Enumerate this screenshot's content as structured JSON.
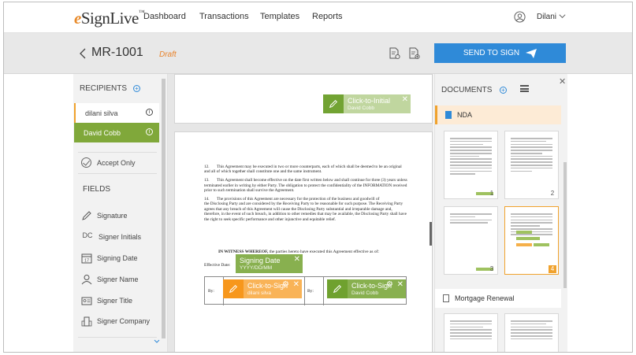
{
  "nav": {
    "logo_e": "e",
    "logo_rest": "SignLive",
    "logo_tm": "™",
    "items": [
      "Dashboard",
      "Transactions",
      "Templates",
      "Reports"
    ],
    "user": "Dilani"
  },
  "header": {
    "title": "MR-1001",
    "status": "Draft",
    "send_label": "SEND TO SIGN"
  },
  "left": {
    "recipients_label": "RECIPIENTS",
    "recipients": [
      "dilani silva",
      "David Cobb"
    ],
    "accept_only_label": "Accept Only",
    "fields_label": "FIELDS",
    "fields": [
      {
        "icon": "pen-icon",
        "label": "Signature"
      },
      {
        "icon": "dc-icon",
        "icon_text": "DC",
        "label": "Signer Initials"
      },
      {
        "icon": "calendar-icon",
        "icon_text": "17",
        "label": "Signing Date"
      },
      {
        "icon": "person-icon",
        "label": "Signer Name"
      },
      {
        "icon": "id-card-icon",
        "label": "Signer Title"
      },
      {
        "icon": "building-icon",
        "label": "Signer Company"
      }
    ]
  },
  "doc": {
    "initial_field": {
      "label": "Click-to-Initial",
      "name": "David Cobb"
    },
    "para12": "This Agreement may be executed in two or more counterparts, each of which shall be deemed to be an original and all of which together shall constitute one and the same instrument.",
    "para13": "This Agreement shall become effective on the date first written below and shall continue for three (3) years unless terminated earlier in writing by either Party. The obligation to protect the confidentiality of the INFORMATION received prior to such termination shall survive the Agreement.",
    "para14a": "The provisions of this Agreement are necessary for the protection of the business and goodwill of",
    "para14b": "the Disclosing Party and are considered by the Receiving Party to be reasonable for such purpose. The Receiving Party agrees that any breach of this Agreement will cause the Disclosing Party substantial and irreparable damage and, therefore, in the event of such breach, in addition to other remedies that may be available, the Disclosing Party shall have the right to seek specific performance and other injunctive and equitable relief.",
    "num12": "12.",
    "num13": "13.",
    "num14": "14.",
    "witness_bold": "IN WITNESS WHEREOF,",
    "witness_rest": " the parties hereto have executed this Agreement effective as of:",
    "effective_label": "Effective Date:",
    "signing_date": {
      "label": "Signing Date",
      "format": "YYYY/DD/MM"
    },
    "by_label": "By:",
    "sig_orange": {
      "label": "Click-to-Sign",
      "name": "dilani silva"
    },
    "sig_green": {
      "label": "Click-to-Sign",
      "name": "David Cobb"
    }
  },
  "right": {
    "documents_label": "DOCUMENTS",
    "groups": [
      {
        "name": "NDA",
        "pages": [
          "1",
          "2",
          "3",
          "4"
        ],
        "selected_page": "4"
      },
      {
        "name": "Mortgage Renewal"
      }
    ]
  },
  "colors": {
    "accent_blue": "#2f8ad8",
    "green_signer": "#80a83a",
    "orange_signer": "#f0a22d",
    "draft_orange": "#e8822a"
  }
}
